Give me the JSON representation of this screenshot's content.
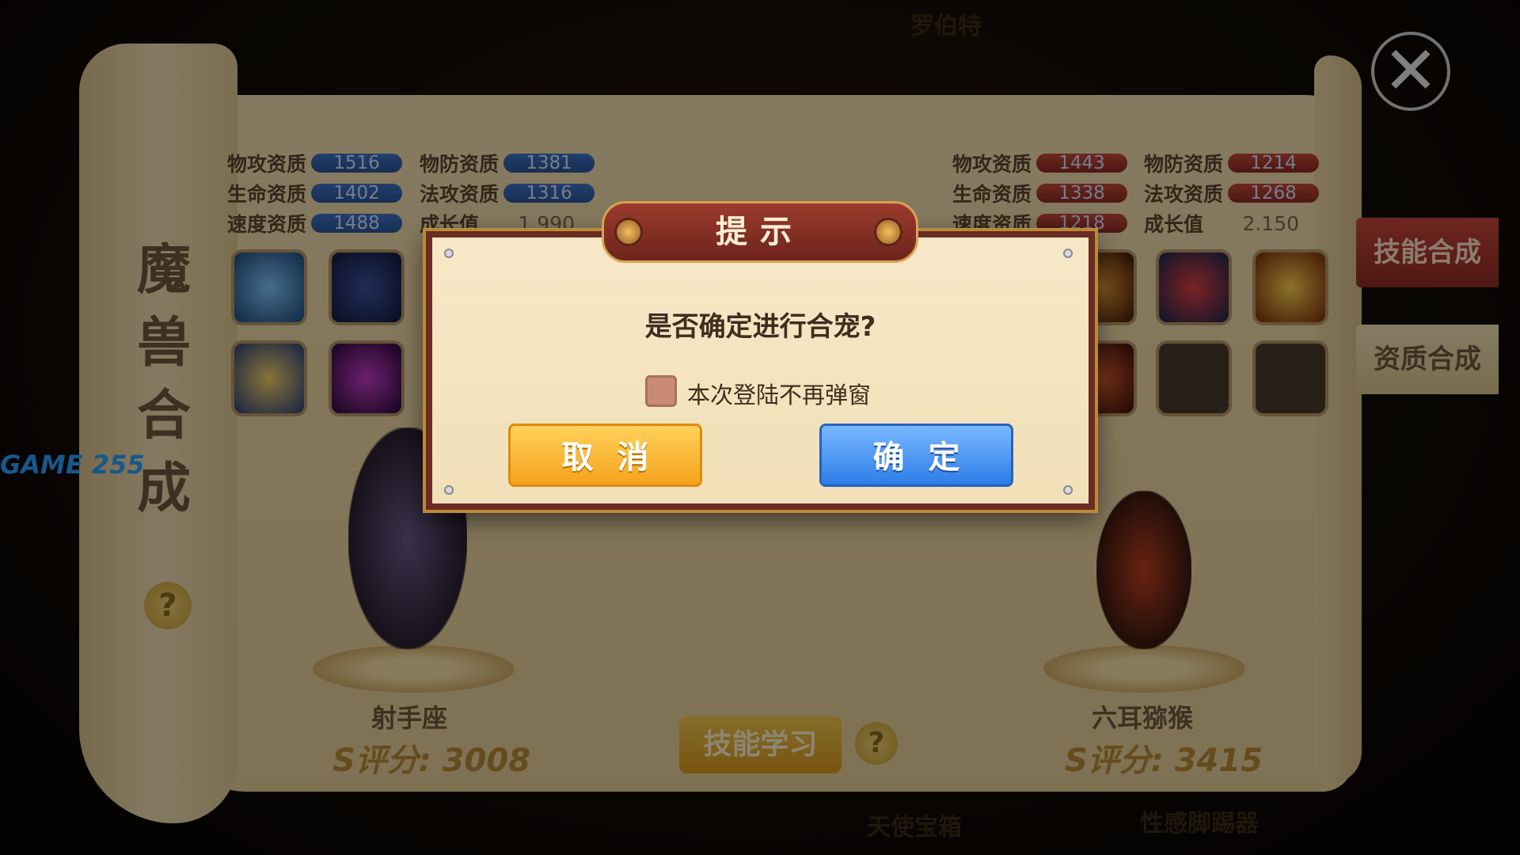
{
  "background_labels": {
    "top_left": "",
    "top_center": "罗伯特",
    "bottom_center": "天使宝箱",
    "bottom_right": "性感脚踢器"
  },
  "side_title": "魔兽合成",
  "tabs": {
    "skill": "技能合成",
    "quality": "资质合成"
  },
  "left_pet": {
    "stats": [
      {
        "label": "物攻资质",
        "value": "1516"
      },
      {
        "label": "物防资质",
        "value": "1381"
      },
      {
        "label": "生命资质",
        "value": "1402"
      },
      {
        "label": "法攻资质",
        "value": "1316"
      },
      {
        "label": "速度资质",
        "value": "1488"
      }
    ],
    "growth_label": "成长值",
    "growth_value": "1.990",
    "name": "射手座",
    "score": "S评分: 3008"
  },
  "right_pet": {
    "stats": [
      {
        "label": "物攻资质",
        "value": "1443"
      },
      {
        "label": "物防资质",
        "value": "1214"
      },
      {
        "label": "生命资质",
        "value": "1338"
      },
      {
        "label": "法攻资质",
        "value": "1268"
      },
      {
        "label": "速度资质",
        "value": "1218"
      }
    ],
    "growth_label": "成长值",
    "growth_value": "2.150",
    "name": "六耳猕猴",
    "score": "S评分: 3415"
  },
  "learn_button": "技能学习",
  "help_symbol": "?",
  "close_symbol": "✕",
  "dialog": {
    "title": "提示",
    "message": "是否确定进行合宠?",
    "checkbox_label": "本次登陆不再弹窗",
    "cancel": "取消",
    "confirm": "确定"
  },
  "watermark": "GAME 255",
  "colors": {
    "dialog_frame": "#6b2c22",
    "cancel": "#f5a21c",
    "confirm": "#2d7ee8",
    "stat_bar_left": "#3f73c7",
    "stat_bar_right": "#c44a3c"
  }
}
